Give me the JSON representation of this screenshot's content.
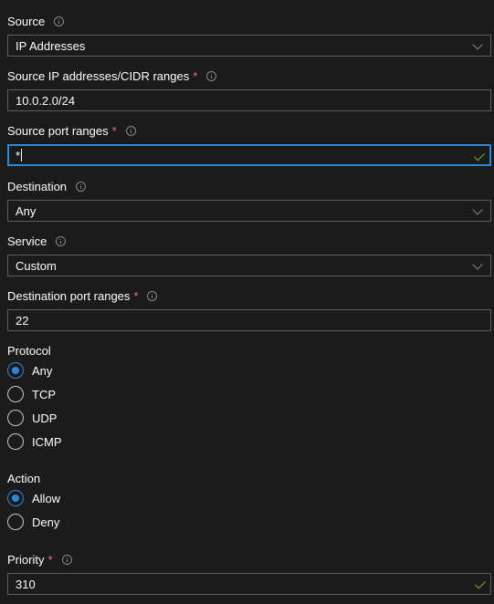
{
  "source": {
    "label": "Source",
    "value": "IP Addresses"
  },
  "source_ip": {
    "label": "Source IP addresses/CIDR ranges",
    "required_marker": "*",
    "value": "10.0.2.0/24"
  },
  "source_port": {
    "label": "Source port ranges",
    "required_marker": "*",
    "value": "*"
  },
  "destination": {
    "label": "Destination",
    "value": "Any"
  },
  "service": {
    "label": "Service",
    "value": "Custom"
  },
  "destination_port": {
    "label": "Destination port ranges",
    "required_marker": "*",
    "value": "22"
  },
  "protocol": {
    "label": "Protocol",
    "options": [
      "Any",
      "TCP",
      "UDP",
      "ICMP"
    ],
    "selected": "Any"
  },
  "action": {
    "label": "Action",
    "options": [
      "Allow",
      "Deny"
    ],
    "selected": "Allow"
  },
  "priority": {
    "label": "Priority",
    "required_marker": "*",
    "value": "310"
  },
  "colors": {
    "background": "#1b1b1b",
    "accent": "#2b88d8",
    "required": "#f1707b",
    "valid": "#6bb700",
    "border": "#605e5c"
  },
  "icons": [
    "info-icon",
    "chevron-down-icon",
    "checkmark-icon"
  ]
}
